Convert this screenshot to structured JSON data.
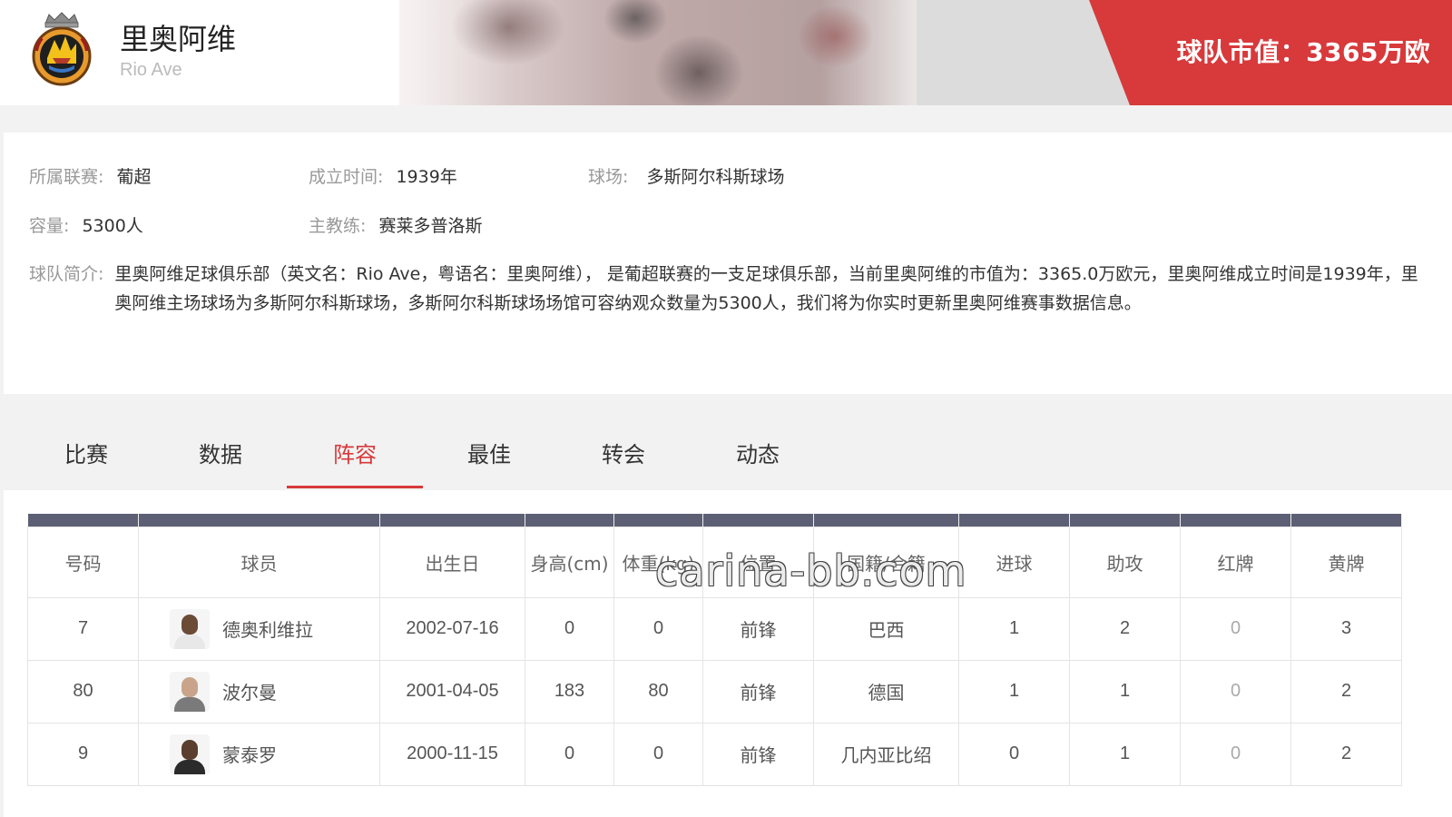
{
  "header": {
    "team_name": "里奥阿维",
    "team_name_en": "Rio Ave",
    "market_value": "球队市值：3365万欧",
    "logo_icon": "club-crest-icon"
  },
  "info": {
    "league_label": "所属联赛:",
    "league_value": "葡超",
    "founded_label": "成立时间:",
    "founded_value": "1939年",
    "stadium_label": "球场:",
    "stadium_value": "多斯阿尔科斯球场",
    "capacity_label": "容量:",
    "capacity_value": "5300人",
    "coach_label": "主教练:",
    "coach_value": "赛莱多普洛斯",
    "intro_label": "球队简介:",
    "intro_text": "里奥阿维足球俱乐部（英文名：Rio Ave，粤语名：里奥阿维）， 是葡超联赛的一支足球俱乐部，当前里奥阿维的市值为：3365.0万欧元，里奥阿维成立时间是1939年，里奥阿维主场球场为多斯阿尔科斯球场，多斯阿尔科斯球场场馆可容纳观众数量为5300人，我们将为你实时更新里奥阿维赛事数据信息。"
  },
  "tabs": [
    {
      "label": "比赛"
    },
    {
      "label": "数据"
    },
    {
      "label": "阵容",
      "active": true
    },
    {
      "label": "最佳"
    },
    {
      "label": "转会"
    },
    {
      "label": "动态"
    }
  ],
  "table": {
    "headers": [
      "号码",
      "球员",
      "出生日",
      "身高(cm)",
      "体重(kg)",
      "位置",
      "国籍/合籍",
      "进球",
      "助攻",
      "红牌",
      "黄牌"
    ],
    "rows": [
      {
        "number": "7",
        "player": "德奥利维拉",
        "birth": "2002-07-16",
        "height": "0",
        "weight": "0",
        "position": "前锋",
        "nationality": "巴西",
        "goals": "1",
        "assists": "2",
        "red": "0",
        "yellow": "3"
      },
      {
        "number": "80",
        "player": "波尔曼",
        "birth": "2001-04-05",
        "height": "183",
        "weight": "80",
        "position": "前锋",
        "nationality": "德国",
        "goals": "1",
        "assists": "1",
        "red": "0",
        "yellow": "2"
      },
      {
        "number": "9",
        "player": "蒙泰罗",
        "birth": "2000-11-15",
        "height": "0",
        "weight": "0",
        "position": "前锋",
        "nationality": "几内亚比绍",
        "goals": "0",
        "assists": "1",
        "red": "0",
        "yellow": "2"
      }
    ]
  },
  "watermark": "carina-bb.com",
  "colors": {
    "accent": "#d8393b",
    "table_header_bar": "#5d6074"
  }
}
